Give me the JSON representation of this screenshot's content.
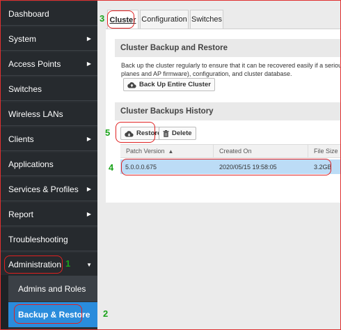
{
  "sidebar": {
    "items": [
      {
        "label": "Dashboard",
        "has_arrow": false
      },
      {
        "label": "System",
        "has_arrow": true
      },
      {
        "label": "Access Points",
        "has_arrow": true
      },
      {
        "label": "Switches",
        "has_arrow": false
      },
      {
        "label": "Wireless LANs",
        "has_arrow": false
      },
      {
        "label": "Clients",
        "has_arrow": true
      },
      {
        "label": "Applications",
        "has_arrow": false
      },
      {
        "label": "Services & Profiles",
        "has_arrow": true
      },
      {
        "label": "Report",
        "has_arrow": true
      },
      {
        "label": "Troubleshooting",
        "has_arrow": false
      },
      {
        "label": "Administration",
        "expanded": true
      }
    ],
    "sub_items": [
      {
        "label": "Admins and Roles",
        "active": false
      },
      {
        "label": "Backup & Restore",
        "active": true
      }
    ]
  },
  "tabs": [
    "Cluster",
    "Configuration",
    "Switches"
  ],
  "active_tab": "Cluster",
  "cluster_backup": {
    "title": "Cluster Backup and Restore",
    "description_line1": "Back up the cluster regularly to ensure that it can be recovered easily if a serious erro",
    "description_line2": "planes and AP firmware), configuration, and cluster database.",
    "backup_button": "Back Up Entire Cluster"
  },
  "history": {
    "title": "Cluster Backups History",
    "restore_button": "Restore",
    "delete_button": "Delete",
    "columns": [
      "Patch Version",
      "Created On",
      "File Size"
    ],
    "sort_indicator": "▲",
    "rows": [
      {
        "patch_version": "5.0.0.0.675",
        "created_on": "2020/05/15 19:58:05",
        "file_size": "3.2GB",
        "selected": true
      }
    ]
  },
  "annotations": {
    "n1": "1",
    "n2": "2",
    "n3": "3",
    "n4": "4",
    "n5": "5"
  },
  "colors": {
    "sidebar_bg": "#262a2e",
    "active_sub": "#2a8cdc",
    "selected_row": "#bcdcf6",
    "annotation_box": "#e02020",
    "annotation_number": "#1aa31a"
  }
}
